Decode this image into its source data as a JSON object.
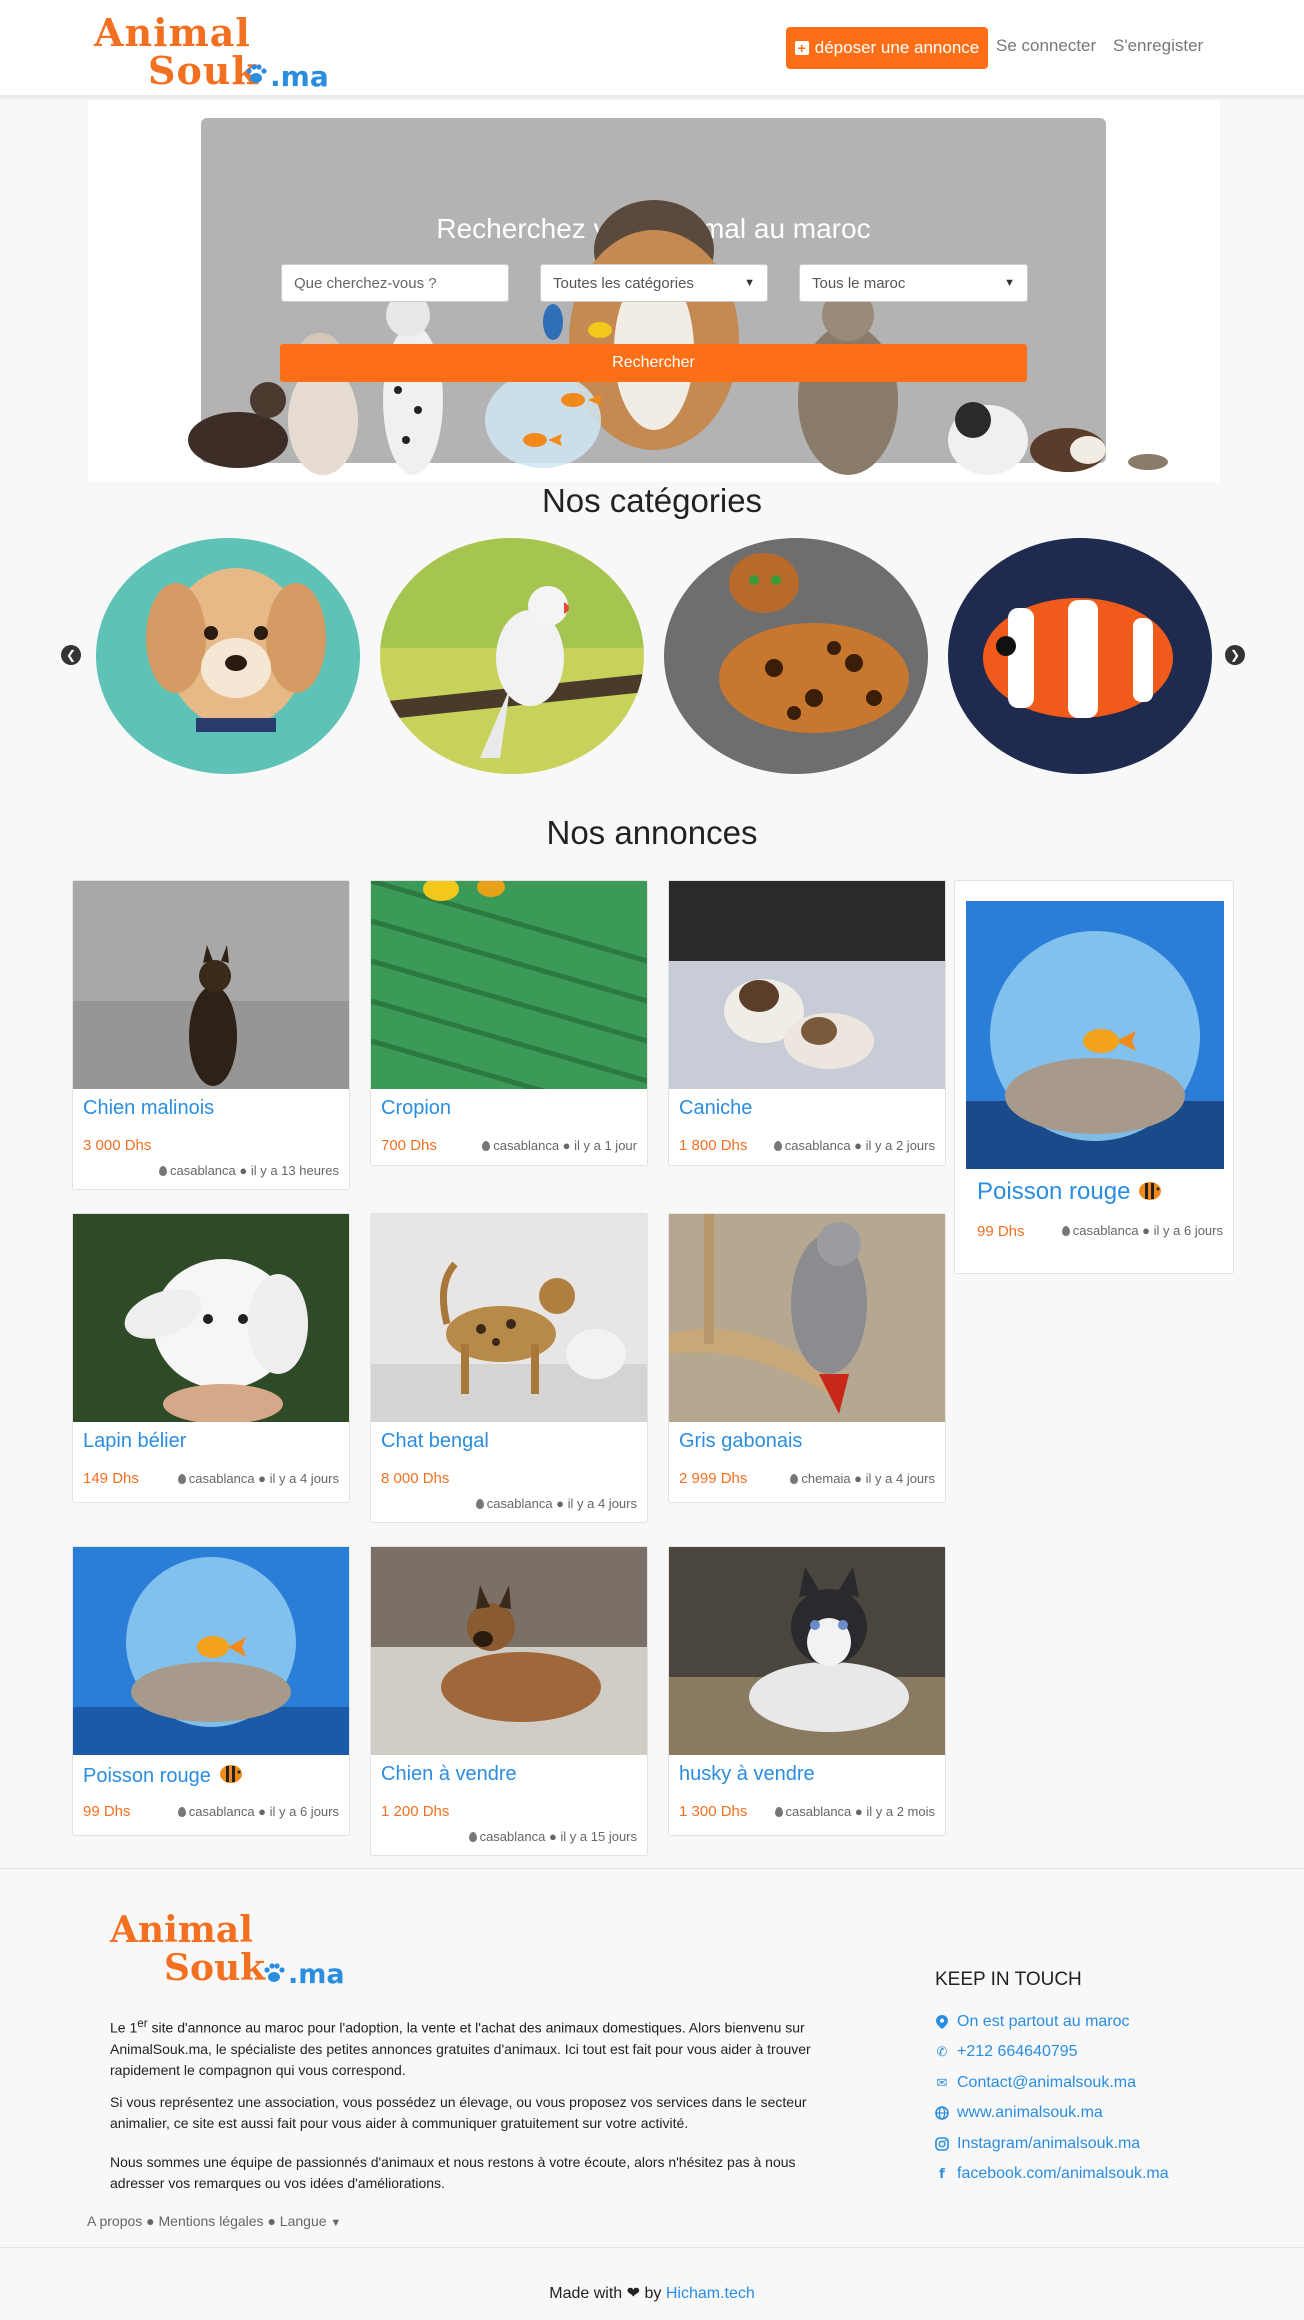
{
  "header": {
    "logo": {
      "line1": "Animal",
      "line2": "Souk",
      "line3": ".ma"
    },
    "post_ad_label": "déposer une annonce",
    "login_label": "Se connecter",
    "register_label": "S'enregister"
  },
  "hero": {
    "title": "Recherchez votre animal au maroc",
    "search_placeholder": "Que cherchez-vous ?",
    "category_select": "Toutes les catégories",
    "region_select": "Tous le maroc",
    "search_button": "Rechercher"
  },
  "categories": {
    "title": "Nos catégories",
    "items": [
      "chiens",
      "oiseaux",
      "chats",
      "poissons"
    ]
  },
  "ads": {
    "title": "Nos annonces",
    "items": [
      {
        "title": "Chien malinois",
        "price": "3 000 Dhs",
        "meta": "casablanca ● il y a 13 heures"
      },
      {
        "title": "Cropion",
        "price": "700 Dhs",
        "meta": "casablanca ● il y a 1 jour"
      },
      {
        "title": "Caniche",
        "price": "1 800 Dhs",
        "meta": "casablanca ● il y a 2 jours"
      },
      {
        "title": "Poisson rouge",
        "price": "99 Dhs",
        "meta": "casablanca ● il y a 6 jours"
      },
      {
        "title": "Lapin bélier",
        "price": "149 Dhs",
        "meta": "casablanca ● il y a 4 jours"
      },
      {
        "title": "Chat bengal",
        "price": "8 000 Dhs",
        "meta": "casablanca ● il y a 4 jours"
      },
      {
        "title": "Gris gabonais",
        "price": "2 999 Dhs",
        "meta": "chemaia ● il y a 4 jours"
      },
      {
        "title": "Poisson rouge",
        "price": "99 Dhs",
        "meta": "casablanca ● il y a 6 jours"
      },
      {
        "title": "Chien à vendre",
        "price": "1 200 Dhs",
        "meta": "casablanca ● il y a 15 jours"
      },
      {
        "title": "husky à vendre",
        "price": "1 300 Dhs",
        "meta": "casablanca ● il y a 2 mois"
      }
    ]
  },
  "footer": {
    "p1_pre": "Le 1",
    "p1_sup": "er",
    "p1_post": " site d'annonce au maroc pour l'adoption, la vente et l'achat des animaux domestiques. Alors bienvenu sur AnimalSouk.ma, le spécialiste des petites annonces gratuites d'animaux. Ici tout est fait pour vous aider à trouver rapidement le compagnon qui vous correspond.",
    "p2": "Si vous représentez une association, vous possédez un élevage, ou vous proposez vos services dans le secteur animalier, ce site est aussi fait pour vous aider à communiquer gratuitement sur votre activité.",
    "p3": "Nous sommes une équipe de passionnés d'animaux et nous restons à votre écoute, alors n'hésitez pas à nous adresser vos remarques ou vos idées d'améliorations.",
    "links": "A propos ● Mentions légales ● Langue",
    "keep_in_touch": "KEEP IN TOUCH",
    "contacts": [
      {
        "icon": "map-marker-icon",
        "text": "On est partout au maroc"
      },
      {
        "icon": "phone-icon",
        "text": "+212 664640795"
      },
      {
        "icon": "envelope-icon",
        "text": "Contact@animalsouk.ma"
      },
      {
        "icon": "globe-icon",
        "text": "www.animalsouk.ma"
      },
      {
        "icon": "instagram-icon",
        "text": "Instagram/animalsouk.ma"
      },
      {
        "icon": "facebook-icon",
        "text": "facebook.com/animalsouk.ma"
      }
    ],
    "made_with": "Made with",
    "by": "by",
    "author": "Hicham.tech"
  },
  "colors": {
    "accent": "#fd6f17",
    "link": "#2a8de0"
  }
}
